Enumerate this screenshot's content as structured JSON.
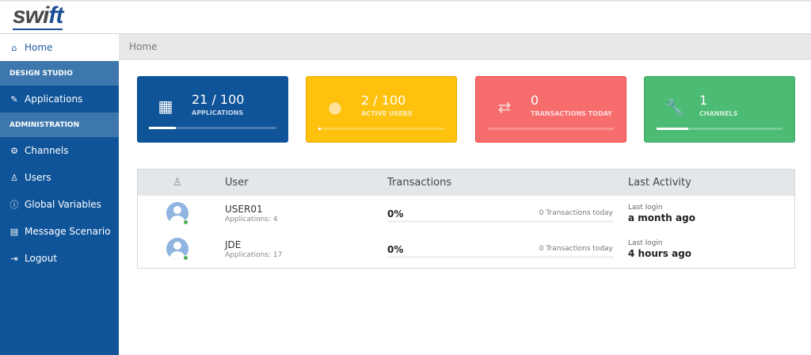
{
  "header": {
    "logo": "swift"
  },
  "sidebar": {
    "home": "Home",
    "section_design": "DESIGN STUDIO",
    "applications": "Applications",
    "section_admin": "ADMINISTRATION",
    "items": [
      {
        "label": "Channels",
        "icon": "gear-icon"
      },
      {
        "label": "Users",
        "icon": "user-icon"
      },
      {
        "label": "Global Variables",
        "icon": "info-icon"
      },
      {
        "label": "Message Scenario",
        "icon": "list-icon"
      },
      {
        "label": "Logout",
        "icon": "logout-icon"
      }
    ]
  },
  "breadcrumb": "Home",
  "cards": [
    {
      "value": "21 / 100",
      "label": "APPLICATIONS",
      "progress": 21,
      "color": "#0f5499",
      "icon": "calculator-icon"
    },
    {
      "value": "2 / 100",
      "label": "ACTIVE USERS",
      "progress": 2,
      "color": "#fdc10e",
      "icon": "user-icon"
    },
    {
      "value": "0",
      "label": "TRANSACTIONS TODAY",
      "progress": 0,
      "color": "#f76d6d",
      "icon": "exchange-icon"
    },
    {
      "value": "1",
      "label": "CHANNELS",
      "progress": 25,
      "color": "#4cbb73",
      "icon": "wrench-icon"
    }
  ],
  "table": {
    "headers": {
      "user": "User",
      "transactions": "Transactions",
      "last_activity": "Last Activity"
    },
    "rows": [
      {
        "name": "USER01",
        "apps": "Applications: 4",
        "pct": "0%",
        "tx": "0 Transactions today",
        "login_label": "Last login",
        "login": "a month ago"
      },
      {
        "name": "JDE",
        "apps": "Applications: 17",
        "pct": "0%",
        "tx": "0 Transactions today",
        "login_label": "Last login",
        "login": "4 hours ago"
      }
    ]
  }
}
